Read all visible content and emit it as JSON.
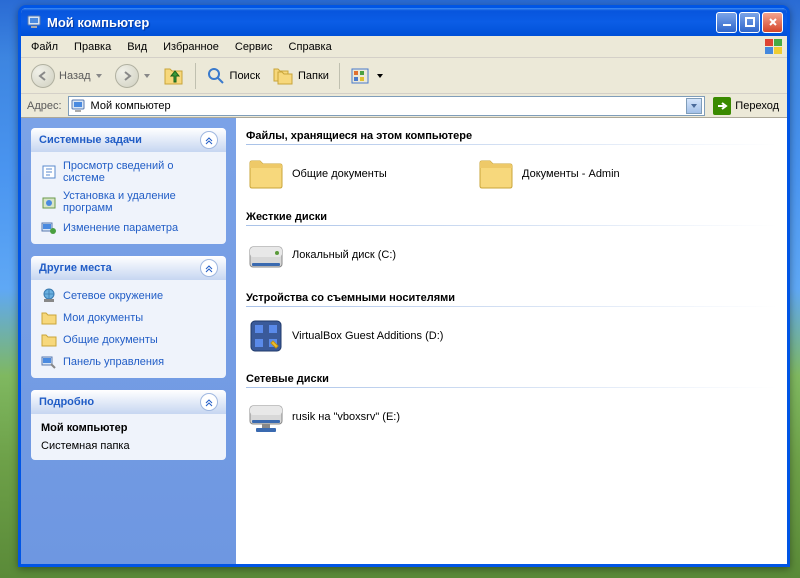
{
  "window": {
    "title": "Мой компьютер"
  },
  "menu": {
    "file": "Файл",
    "edit": "Правка",
    "view": "Вид",
    "favorites": "Избранное",
    "tools": "Сервис",
    "help": "Справка"
  },
  "toolbar": {
    "back": "Назад",
    "search": "Поиск",
    "folders": "Папки"
  },
  "addressbar": {
    "label": "Адрес:",
    "value": "Мой компьютер",
    "go": "Переход"
  },
  "sidepanel": {
    "system_tasks": {
      "title": "Системные задачи",
      "items": [
        "Просмотр сведений о системе",
        "Установка и удаление программ",
        "Изменение параметра"
      ]
    },
    "other_places": {
      "title": "Другие места",
      "items": [
        "Сетевое окружение",
        "Мои документы",
        "Общие документы",
        "Панель управления"
      ]
    },
    "details": {
      "title": "Подробно",
      "line1": "Мой компьютер",
      "line2": "Системная папка"
    }
  },
  "sections": {
    "files": {
      "title": "Файлы, хранящиеся на этом компьютере",
      "items": [
        "Общие документы",
        "Документы - Admin"
      ]
    },
    "hdd": {
      "title": "Жесткие диски",
      "items": [
        "Локальный диск (C:)"
      ]
    },
    "removable": {
      "title": "Устройства со съемными носителями",
      "items": [
        "VirtualBox Guest Additions (D:)"
      ]
    },
    "network": {
      "title": "Сетевые диски",
      "items": [
        "rusik на \"vboxsrv\" (E:)"
      ]
    }
  }
}
